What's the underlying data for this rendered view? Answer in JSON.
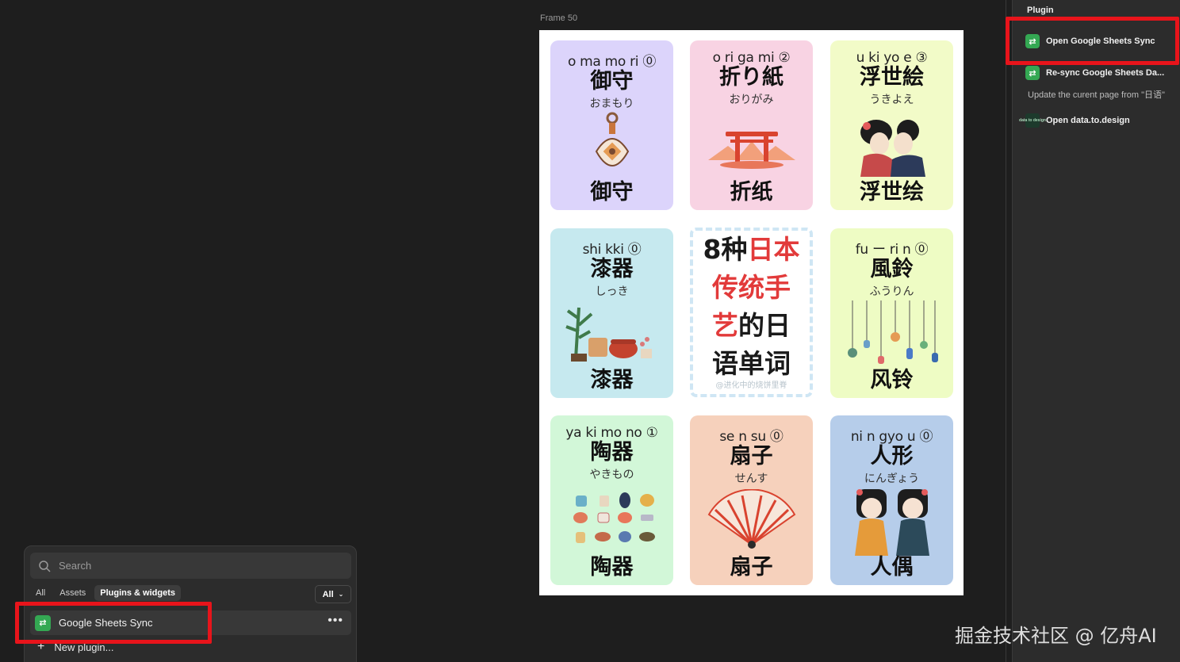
{
  "frame": {
    "label": "Frame 50"
  },
  "cards": [
    {
      "romaji": "o ma mo ri ⓪",
      "kanji": "御守",
      "kana": "おまもり",
      "zh": "御守",
      "bg": "#dcd4fb",
      "illus": "omamori-charm-icon"
    },
    {
      "romaji": "o ri ga mi ②",
      "kanji": "折り紙",
      "kana": "おりがみ",
      "zh": "折纸",
      "bg": "#f8d3e3",
      "illus": "torii-gate-icon"
    },
    {
      "romaji": "u ki yo e ③",
      "kanji": "浮世絵",
      "kana": "うきよえ",
      "zh": "浮世绘",
      "bg": "#f2fbc8",
      "illus": "ukiyoe-couple-icon"
    },
    {
      "romaji": "shi kki ⓪",
      "kanji": "漆器",
      "kana": "しっき",
      "zh": "漆器",
      "bg": "#c6e9ef",
      "illus": "lacquerware-icon"
    },
    {
      "romaji": "fu ー ri n ⓪",
      "kanji": "風鈴",
      "kana": "ふうりん",
      "zh": "风铃",
      "bg": "#eefcc4",
      "illus": "wind-chimes-icon"
    },
    {
      "romaji": "ya ki mo no ①",
      "kanji": "陶器",
      "kana": "やきもの",
      "zh": "陶器",
      "bg": "#d2f7d8",
      "illus": "pottery-icon"
    },
    {
      "romaji": "se n su ⓪",
      "kanji": "扇子",
      "kana": "せんす",
      "zh": "扇子",
      "bg": "#f6d1bc",
      "illus": "folding-fan-icon"
    },
    {
      "romaji": "ni n gyo u ⓪",
      "kanji": "人形",
      "kana": "にんぎょう",
      "zh": "人偶",
      "bg": "#b6cdea",
      "illus": "dolls-icon"
    }
  ],
  "center": {
    "l1a": "8种",
    "l1b": "日本",
    "l2": "传统手",
    "l3a": "艺",
    "l3b": "的日",
    "l4": "语单词",
    "credit": "@进化中的烧饼里脊"
  },
  "right_panel": {
    "title": "Plugin",
    "open_sync": "Open Google Sheets Sync",
    "resync": "Re-sync Google Sheets Da...",
    "resync_sub": "Update the curent page from \"日语\"",
    "open_dtd": "Open data.to.design",
    "dtd_icon_text": "data to design"
  },
  "popover": {
    "search_placeholder": "Search",
    "tabs": [
      "All",
      "Assets",
      "Plugins & widgets"
    ],
    "filter": "All",
    "plugin_name": "Google Sheets Sync",
    "new_plugin": "New plugin..."
  },
  "watermark": "掘金技术社区 @ 亿舟AI",
  "colors": {
    "highlight": "#e8141b",
    "gs_green": "#34a853",
    "panel_bg": "#2c2c2c",
    "canvas_bg": "#1e1e1e"
  }
}
